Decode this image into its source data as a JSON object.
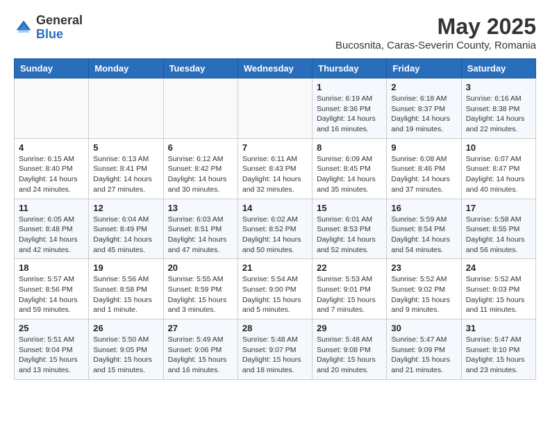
{
  "logo": {
    "general": "General",
    "blue": "Blue"
  },
  "title": "May 2025",
  "location": "Bucosnita, Caras-Severin County, Romania",
  "days_header": [
    "Sunday",
    "Monday",
    "Tuesday",
    "Wednesday",
    "Thursday",
    "Friday",
    "Saturday"
  ],
  "weeks": [
    [
      {
        "day": "",
        "info": ""
      },
      {
        "day": "",
        "info": ""
      },
      {
        "day": "",
        "info": ""
      },
      {
        "day": "",
        "info": ""
      },
      {
        "day": "1",
        "info": "Sunrise: 6:19 AM\nSunset: 8:36 PM\nDaylight: 14 hours\nand 16 minutes."
      },
      {
        "day": "2",
        "info": "Sunrise: 6:18 AM\nSunset: 8:37 PM\nDaylight: 14 hours\nand 19 minutes."
      },
      {
        "day": "3",
        "info": "Sunrise: 6:16 AM\nSunset: 8:38 PM\nDaylight: 14 hours\nand 22 minutes."
      }
    ],
    [
      {
        "day": "4",
        "info": "Sunrise: 6:15 AM\nSunset: 8:40 PM\nDaylight: 14 hours\nand 24 minutes."
      },
      {
        "day": "5",
        "info": "Sunrise: 6:13 AM\nSunset: 8:41 PM\nDaylight: 14 hours\nand 27 minutes."
      },
      {
        "day": "6",
        "info": "Sunrise: 6:12 AM\nSunset: 8:42 PM\nDaylight: 14 hours\nand 30 minutes."
      },
      {
        "day": "7",
        "info": "Sunrise: 6:11 AM\nSunset: 8:43 PM\nDaylight: 14 hours\nand 32 minutes."
      },
      {
        "day": "8",
        "info": "Sunrise: 6:09 AM\nSunset: 8:45 PM\nDaylight: 14 hours\nand 35 minutes."
      },
      {
        "day": "9",
        "info": "Sunrise: 6:08 AM\nSunset: 8:46 PM\nDaylight: 14 hours\nand 37 minutes."
      },
      {
        "day": "10",
        "info": "Sunrise: 6:07 AM\nSunset: 8:47 PM\nDaylight: 14 hours\nand 40 minutes."
      }
    ],
    [
      {
        "day": "11",
        "info": "Sunrise: 6:05 AM\nSunset: 8:48 PM\nDaylight: 14 hours\nand 42 minutes."
      },
      {
        "day": "12",
        "info": "Sunrise: 6:04 AM\nSunset: 8:49 PM\nDaylight: 14 hours\nand 45 minutes."
      },
      {
        "day": "13",
        "info": "Sunrise: 6:03 AM\nSunset: 8:51 PM\nDaylight: 14 hours\nand 47 minutes."
      },
      {
        "day": "14",
        "info": "Sunrise: 6:02 AM\nSunset: 8:52 PM\nDaylight: 14 hours\nand 50 minutes."
      },
      {
        "day": "15",
        "info": "Sunrise: 6:01 AM\nSunset: 8:53 PM\nDaylight: 14 hours\nand 52 minutes."
      },
      {
        "day": "16",
        "info": "Sunrise: 5:59 AM\nSunset: 8:54 PM\nDaylight: 14 hours\nand 54 minutes."
      },
      {
        "day": "17",
        "info": "Sunrise: 5:58 AM\nSunset: 8:55 PM\nDaylight: 14 hours\nand 56 minutes."
      }
    ],
    [
      {
        "day": "18",
        "info": "Sunrise: 5:57 AM\nSunset: 8:56 PM\nDaylight: 14 hours\nand 59 minutes."
      },
      {
        "day": "19",
        "info": "Sunrise: 5:56 AM\nSunset: 8:58 PM\nDaylight: 15 hours\nand 1 minute."
      },
      {
        "day": "20",
        "info": "Sunrise: 5:55 AM\nSunset: 8:59 PM\nDaylight: 15 hours\nand 3 minutes."
      },
      {
        "day": "21",
        "info": "Sunrise: 5:54 AM\nSunset: 9:00 PM\nDaylight: 15 hours\nand 5 minutes."
      },
      {
        "day": "22",
        "info": "Sunrise: 5:53 AM\nSunset: 9:01 PM\nDaylight: 15 hours\nand 7 minutes."
      },
      {
        "day": "23",
        "info": "Sunrise: 5:52 AM\nSunset: 9:02 PM\nDaylight: 15 hours\nand 9 minutes."
      },
      {
        "day": "24",
        "info": "Sunrise: 5:52 AM\nSunset: 9:03 PM\nDaylight: 15 hours\nand 11 minutes."
      }
    ],
    [
      {
        "day": "25",
        "info": "Sunrise: 5:51 AM\nSunset: 9:04 PM\nDaylight: 15 hours\nand 13 minutes."
      },
      {
        "day": "26",
        "info": "Sunrise: 5:50 AM\nSunset: 9:05 PM\nDaylight: 15 hours\nand 15 minutes."
      },
      {
        "day": "27",
        "info": "Sunrise: 5:49 AM\nSunset: 9:06 PM\nDaylight: 15 hours\nand 16 minutes."
      },
      {
        "day": "28",
        "info": "Sunrise: 5:48 AM\nSunset: 9:07 PM\nDaylight: 15 hours\nand 18 minutes."
      },
      {
        "day": "29",
        "info": "Sunrise: 5:48 AM\nSunset: 9:08 PM\nDaylight: 15 hours\nand 20 minutes."
      },
      {
        "day": "30",
        "info": "Sunrise: 5:47 AM\nSunset: 9:09 PM\nDaylight: 15 hours\nand 21 minutes."
      },
      {
        "day": "31",
        "info": "Sunrise: 5:47 AM\nSunset: 9:10 PM\nDaylight: 15 hours\nand 23 minutes."
      }
    ]
  ]
}
